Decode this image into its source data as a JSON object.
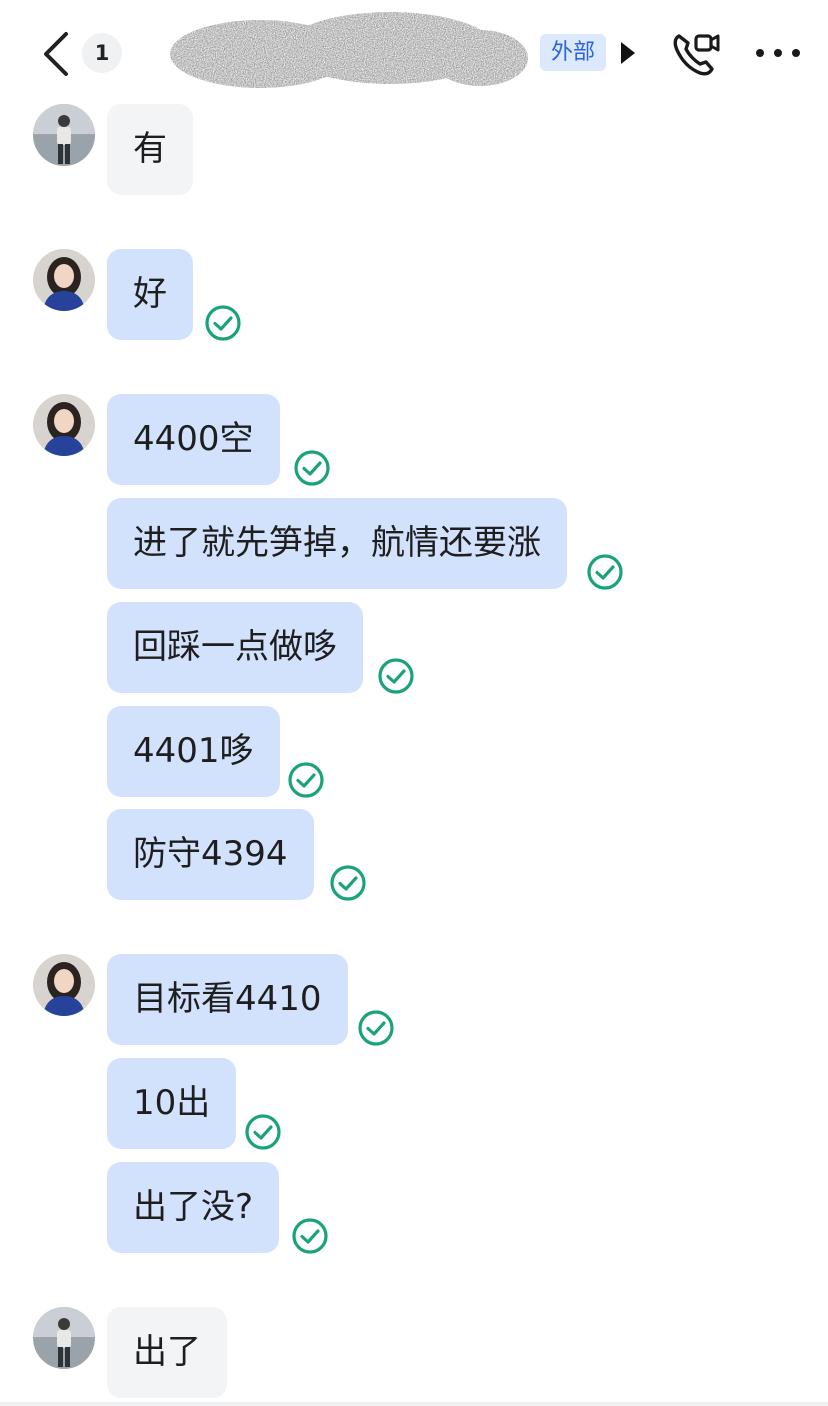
{
  "header": {
    "unread_count": "1",
    "contact_name": "",
    "external_tag": "外部",
    "icons": {
      "back": "chevron-left-icon",
      "expand": "triangle-right-icon",
      "call": "phone-video-icon",
      "more": "ellipsis-icon"
    }
  },
  "messages": [
    {
      "sender": "contact",
      "text": "有"
    },
    {
      "sender": "self",
      "text": "好",
      "status": "read"
    },
    {
      "sender": "self",
      "text": "4400空",
      "status": "read"
    },
    {
      "sender": "self",
      "text": "进了就先笋掉，航情还要涨",
      "status": "read"
    },
    {
      "sender": "self",
      "text": "回踩一点做哆",
      "status": "read"
    },
    {
      "sender": "self",
      "text": "4401哆",
      "status": "read"
    },
    {
      "sender": "self",
      "text": "防守4394",
      "status": "read"
    },
    {
      "sender": "self",
      "text": "目标看4410",
      "status": "read"
    },
    {
      "sender": "self",
      "text": "10出",
      "status": "read"
    },
    {
      "sender": "self",
      "text": "出了没?",
      "status": "read"
    },
    {
      "sender": "contact",
      "text": "出了"
    }
  ],
  "colors": {
    "self_bubble": "#d2e2fd",
    "contact_bubble": "#f3f4f6",
    "read_check": "#1aa37a",
    "tag_bg": "#dce8fb",
    "tag_text": "#2a66d6"
  }
}
